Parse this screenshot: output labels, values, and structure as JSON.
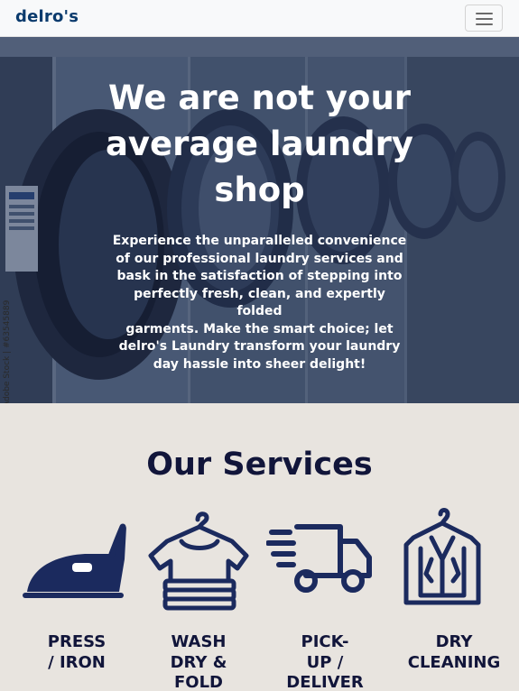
{
  "navbar": {
    "brand": "delro's",
    "menu_icon": "hamburger-menu-icon"
  },
  "hero": {
    "title_lines": [
      "We are not your",
      "average laundry",
      "shop"
    ],
    "description_lines": [
      "Experience the unparalleled convenience",
      "of our professional laundry services and",
      "bask in the satisfaction of stepping into",
      "perfectly fresh, clean, and expertly folded",
      "garments. Make the smart choice; let",
      "delro's Laundry transform your laundry",
      "day hassle into sheer delight!"
    ],
    "watermark": "Adobe Stock | #63545889"
  },
  "services": {
    "title": "Our Services",
    "items": [
      {
        "icon": "iron-icon",
        "label_lines": [
          "PRESS",
          "/ IRON"
        ]
      },
      {
        "icon": "folded-shirt-icon",
        "label_lines": [
          "WASH",
          "DRY &",
          "FOLD"
        ]
      },
      {
        "icon": "delivery-truck-icon",
        "label_lines": [
          "PICK-",
          "UP /",
          "DELIVER"
        ]
      },
      {
        "icon": "garment-bag-icon",
        "label_lines": [
          "DRY",
          "CLEANING"
        ]
      }
    ]
  },
  "colors": {
    "brand": "#0b3b6d",
    "navy": "#11153a",
    "icon_blue": "#1b2a5e",
    "section_bg": "#e8e4df"
  }
}
